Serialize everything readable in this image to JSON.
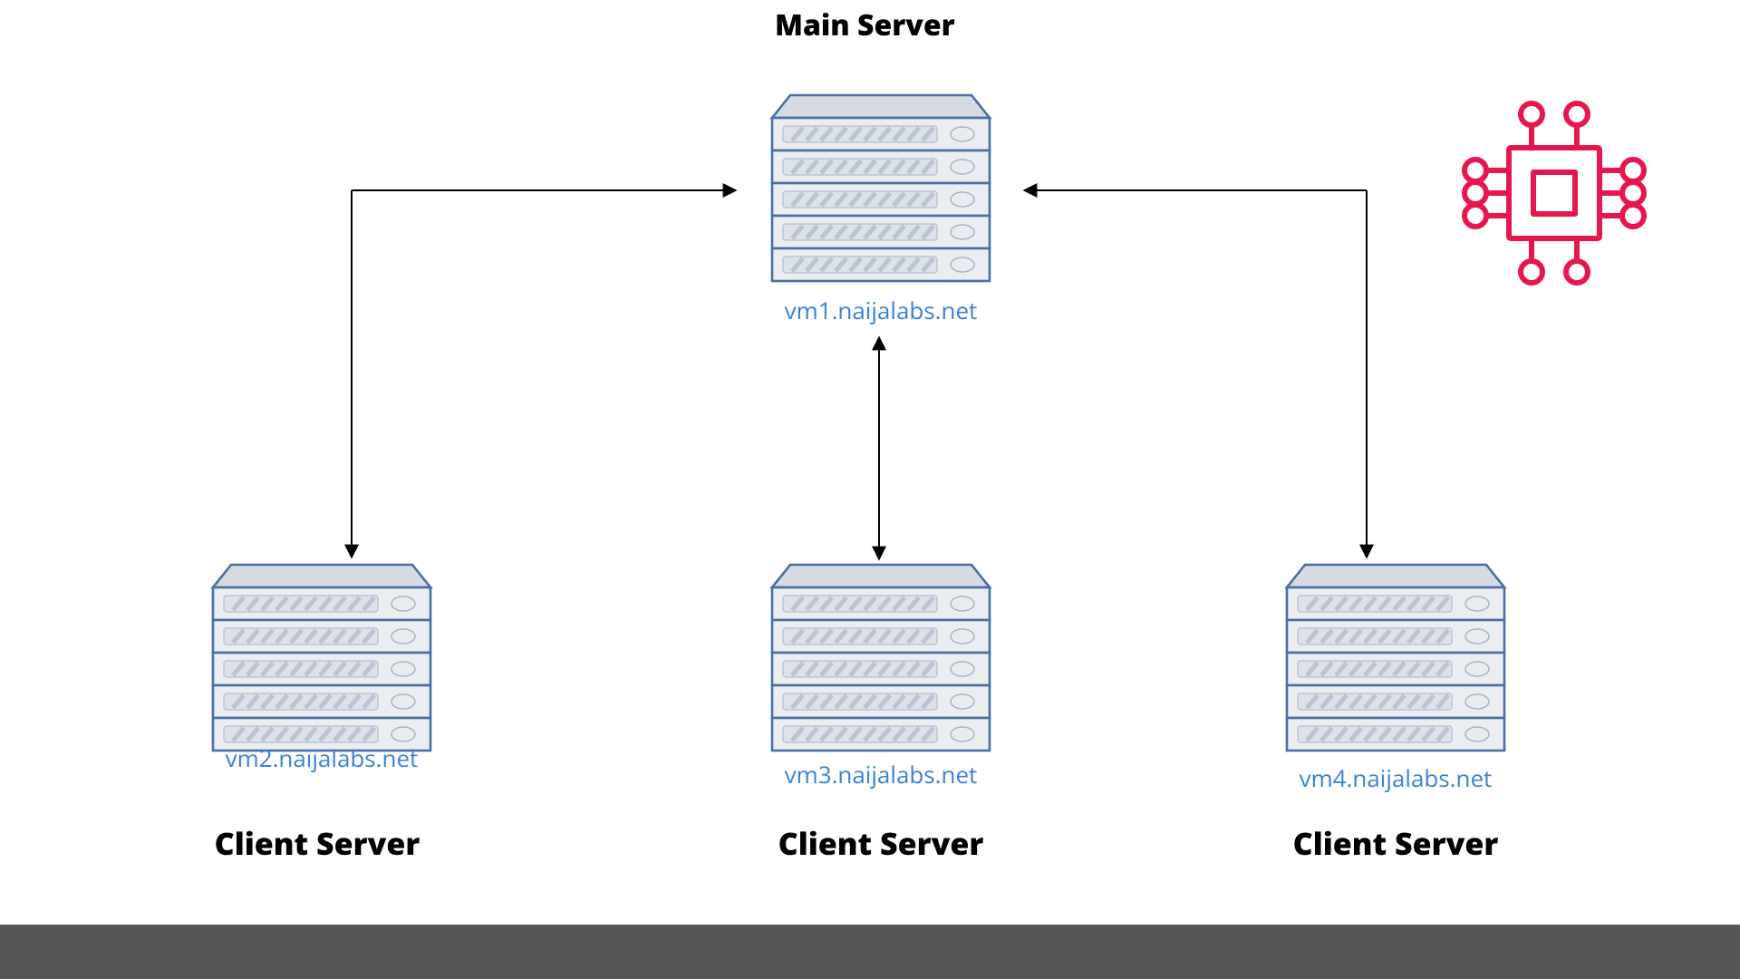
{
  "header": {
    "title": "Main Server"
  },
  "servers": {
    "main": {
      "hostname": "vm1.naijalabs.net",
      "role": "Main Server"
    },
    "left": {
      "hostname": "vm2.naijalabs.net",
      "role": "Client Server"
    },
    "mid": {
      "hostname": "vm3.naijalabs.net",
      "role": "Client Server"
    },
    "right": {
      "hostname": "vm4.naijalabs.net",
      "role": "Client Server"
    }
  },
  "decor": {
    "cpu_icon": "cpu-chip-icon",
    "colors": {
      "accent": "#e7174d",
      "link": "#3b82d6",
      "server_outline": "#4a6fa0"
    }
  }
}
